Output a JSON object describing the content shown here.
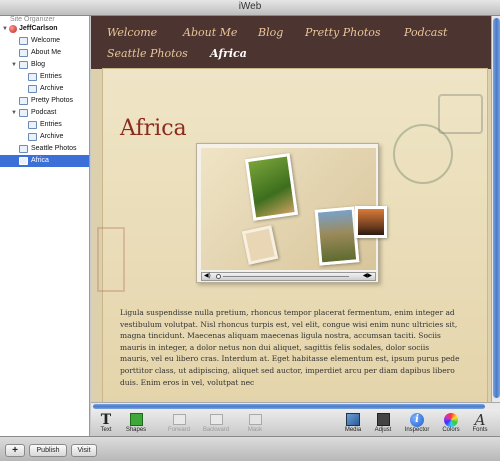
{
  "window": {
    "title": "iWeb"
  },
  "sidebar": {
    "header": "Site Organizer",
    "items": [
      {
        "label": "JeffCarlson",
        "kind": "site"
      },
      {
        "label": "Welcome",
        "kind": "page"
      },
      {
        "label": "About Me",
        "kind": "page"
      },
      {
        "label": "Blog",
        "kind": "section"
      },
      {
        "label": "Entries",
        "kind": "page"
      },
      {
        "label": "Archive",
        "kind": "page"
      },
      {
        "label": "Pretty Photos",
        "kind": "page"
      },
      {
        "label": "Podcast",
        "kind": "section"
      },
      {
        "label": "Entries",
        "kind": "page"
      },
      {
        "label": "Archive",
        "kind": "page"
      },
      {
        "label": "Seattle Photos",
        "kind": "page"
      },
      {
        "label": "Africa",
        "kind": "page",
        "selected": true
      }
    ]
  },
  "bottom_bar": {
    "add": "+",
    "publish": "Publish",
    "visit": "Visit"
  },
  "site_nav": {
    "items": [
      "Welcome",
      "About Me",
      "Blog",
      "Pretty Photos",
      "Podcast",
      "Seattle Photos",
      "Africa"
    ],
    "current": "Africa"
  },
  "page": {
    "title": "Africa",
    "body": "Ligula suspendisse nulla pretium, rhoncus tempor placerat fermentum, enim integer ad vestibulum volutpat. Nisl rhoncus turpis est, vel elit, congue wisi enim nunc ultricies sit, magna tincidunt. Maecenas aliquam maecenas ligula nostra, accumsan taciti. Sociis mauris in integer, a dolor netus non dui aliquet, sagittis felis sodales, dolor sociis mauris, vel eu libero cras. Interdum at. Eget habitasse elementum est, ipsum purus pede porttitor class, ut adipiscing, aliquet sed auctor, imperdiet arcu per diam dapibus libero duis. Enim eros in vel, volutpat nec"
  },
  "toolbar": {
    "text": "Text",
    "shapes": "Shapes",
    "forward": "Forward",
    "backward": "Backward",
    "mask": "Mask",
    "media": "Media",
    "adjust": "Adjust",
    "inspector": "Inspector",
    "colors": "Colors",
    "fonts": "Fonts"
  },
  "colors": {
    "nav_bg": "#4c3430",
    "nav_text": "#e9c69a",
    "title": "#8b2a1e",
    "selection": "#3d6fd9"
  }
}
